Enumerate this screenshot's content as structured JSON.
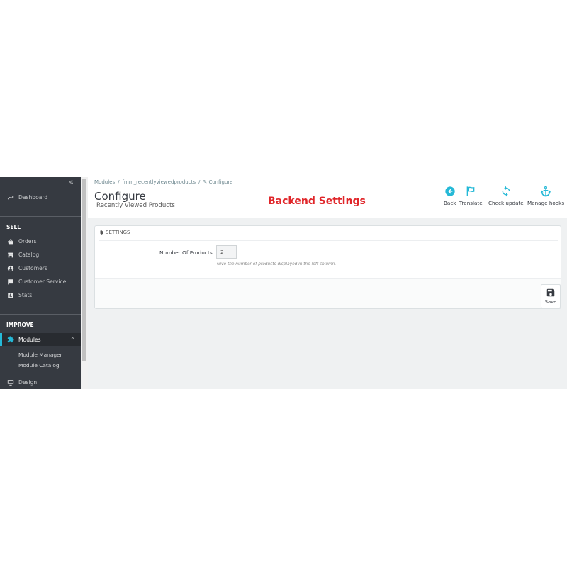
{
  "sidebar": {
    "collapse_label": "«",
    "dashboard": "Dashboard",
    "sections": {
      "sell": "SELL",
      "improve": "IMPROVE"
    },
    "sell_items": [
      {
        "label": "Orders",
        "icon": "cart-icon"
      },
      {
        "label": "Catalog",
        "icon": "store-icon"
      },
      {
        "label": "Customers",
        "icon": "user-icon"
      },
      {
        "label": "Customer Service",
        "icon": "chat-icon"
      },
      {
        "label": "Stats",
        "icon": "bar-chart-icon"
      }
    ],
    "modules": {
      "label": "Modules",
      "chevron": "^"
    },
    "module_sub": [
      "Module Manager",
      "Module Catalog"
    ],
    "design": "Design",
    "accent_color": "#25b9d7"
  },
  "header": {
    "breadcrumb": [
      "Modules",
      "fmm_recentlyviewedproducts",
      "Configure"
    ],
    "title": "Configure",
    "subtitle": "Recently Viewed Products",
    "overlay_label": "Backend Settings",
    "toolbar": {
      "back": "Back",
      "translate": "Translate",
      "check_update": "Check update",
      "manage_hooks": "Manage hooks"
    }
  },
  "panel": {
    "heading": "SETTINGS",
    "field_label": "Number Of Products",
    "field_value": "2",
    "field_help": "Give the number of products displayed in the left column.",
    "save_label": "Save"
  }
}
